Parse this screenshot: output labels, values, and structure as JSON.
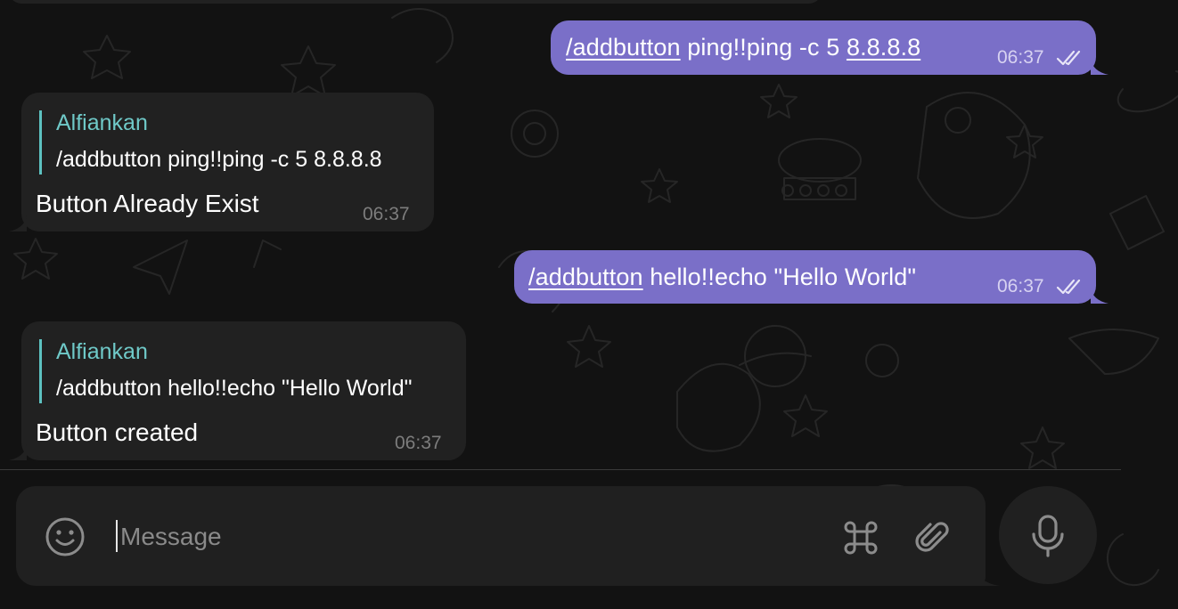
{
  "messages": [
    {
      "direction": "outgoing",
      "command": "/addbutton",
      "args_plain": "ping!!ping -c 5 ",
      "args_link": "8.8.8.8",
      "time": "06:37",
      "status_icon": "double-check-icon"
    },
    {
      "direction": "incoming",
      "quote_author": "Alfiankan",
      "quote_text": "/addbutton ping!!ping -c 5 8.8.8.8",
      "text": "Button Already Exist",
      "time": "06:37"
    },
    {
      "direction": "outgoing",
      "command": "/addbutton",
      "args_plain": " hello!!echo \"Hello World\"",
      "time": "06:37",
      "status_icon": "double-check-icon"
    },
    {
      "direction": "incoming",
      "quote_author": "Alfiankan",
      "quote_text": "/addbutton hello!!echo \"Hello World\"",
      "text": "Button created",
      "time": "06:37"
    }
  ],
  "composer": {
    "placeholder": "Message",
    "value": "",
    "icons": [
      "emoji-icon",
      "command-icon",
      "attachment-icon",
      "microphone-icon"
    ]
  },
  "colors": {
    "background": "#121212",
    "outgoing_bubble": "#7a6fc8",
    "incoming_bubble": "#212121",
    "quote_accent": "#5dc2c1",
    "composer": "#202020"
  }
}
